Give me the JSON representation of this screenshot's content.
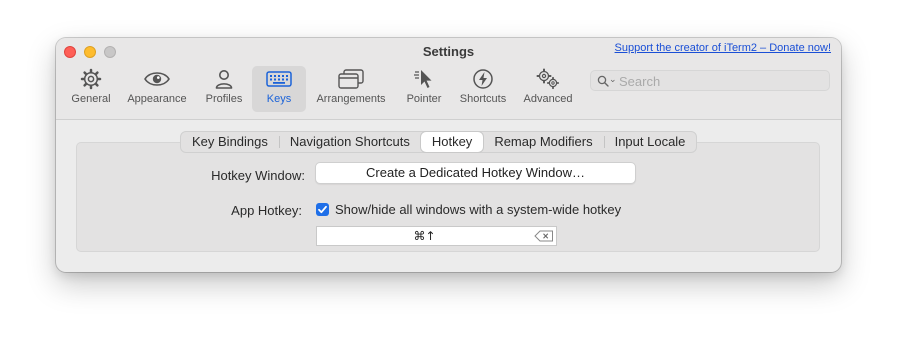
{
  "window": {
    "title": "Settings",
    "donate_link": "Support the creator of iTerm2 – Donate now!"
  },
  "toolbar": {
    "items": [
      {
        "label": "General",
        "icon": "gear-icon"
      },
      {
        "label": "Appearance",
        "icon": "eye-icon"
      },
      {
        "label": "Profiles",
        "icon": "person-icon"
      },
      {
        "label": "Keys",
        "icon": "keyboard-icon",
        "selected": true
      },
      {
        "label": "Arrangements",
        "icon": "windows-icon"
      },
      {
        "label": "Pointer",
        "icon": "pointer-icon"
      },
      {
        "label": "Shortcuts",
        "icon": "bolt-icon"
      },
      {
        "label": "Advanced",
        "icon": "gears-icon"
      }
    ],
    "search_placeholder": "Search"
  },
  "tabs": [
    {
      "label": "Key Bindings"
    },
    {
      "label": "Navigation Shortcuts"
    },
    {
      "label": "Hotkey",
      "active": true
    },
    {
      "label": "Remap Modifiers"
    },
    {
      "label": "Input Locale"
    }
  ],
  "hotkey": {
    "window_label": "Hotkey Window:",
    "window_button": "Create a Dedicated Hotkey Window…",
    "app_label": "App Hotkey:",
    "checkbox_label": "Show/hide all windows with a system-wide hotkey",
    "checkbox_checked": true,
    "shortcut_value": "⌘↑"
  },
  "colors": {
    "accent": "#1f6fe8",
    "link": "#1a4fd6",
    "selected_tab_text": "#1a62d8"
  }
}
